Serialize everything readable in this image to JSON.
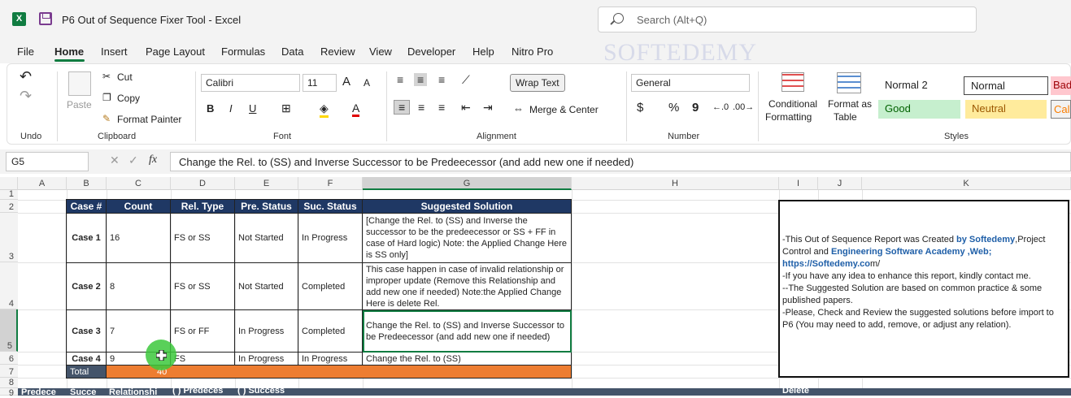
{
  "window": {
    "title": "P6 Out of Sequence Fixer Tool  -  Excel",
    "search_placeholder": "Search (Alt+Q)",
    "app_icon": "X",
    "watermark": "SOFTEDEMY"
  },
  "menu": [
    "File",
    "Home",
    "Insert",
    "Page Layout",
    "Formulas",
    "Data",
    "Review",
    "View",
    "Developer",
    "Help",
    "Nitro Pro"
  ],
  "ribbon": {
    "undo_label": "Undo",
    "clipboard": {
      "paste": "Paste",
      "cut": "Cut",
      "copy": "Copy",
      "format_painter": "Format Painter",
      "label": "Clipboard"
    },
    "font": {
      "name": "Calibri",
      "size": "11",
      "label": "Font",
      "bold": "B",
      "italic": "I",
      "underline": "U",
      "grow": "A",
      "shrink": "A",
      "color": "A"
    },
    "alignment": {
      "wrap_text": "Wrap Text",
      "merge_center": "Merge & Center",
      "label": "Alignment"
    },
    "number": {
      "format": "General",
      "currency": "$",
      "percent": "%",
      "comma": "9",
      "label": "Number"
    },
    "cond_format": {
      "line1": "Conditional",
      "line2": "Formatting"
    },
    "format_table": {
      "line1": "Format as",
      "line2": "Table"
    },
    "styles": {
      "label": "Styles",
      "items": [
        "Normal 2",
        "Normal",
        "Bad",
        "Good",
        "Neutral",
        "Calc"
      ]
    },
    "colors": {
      "good_bg": "#c6efce",
      "good_fg": "#006100",
      "neutral_bg": "#ffeb9c",
      "neutral_fg": "#9c5700",
      "bad_bg": "#ffc7ce",
      "bad_fg": "#9c0006"
    }
  },
  "formula_bar": {
    "cell": "G5",
    "fx": "fx",
    "formula": "Change the Rel. to (SS) and Inverse Successor to be Predeecessor (and add new one if needed)"
  },
  "columns": [
    "A",
    "B",
    "C",
    "D",
    "E",
    "F",
    "G",
    "H",
    "I",
    "J",
    "K"
  ],
  "rows": [
    "1",
    "2",
    "3",
    "4",
    "5",
    "6",
    "7",
    "8",
    "9"
  ],
  "table": {
    "headers": [
      "Case #",
      "Count",
      "Rel. Type",
      "Pre. Status",
      "Suc. Status",
      "Suggested Solution"
    ],
    "rows": [
      {
        "case": "Case 1",
        "count": "16",
        "rel": "FS or SS",
        "pre": "Not Started",
        "suc": "In Progress",
        "solution": "[Change the Rel. to (SS) and Inverse the successor to be the predeecessor or SS + FF in case of Hard logic) Note: the Applied Change Here is SS only]"
      },
      {
        "case": "Case 2",
        "count": "8",
        "rel": "FS or SS",
        "pre": "Not Started",
        "suc": "Completed",
        "solution": "This case happen in case of invalid relationship or improper update (Remove this Relationship and add new one if needed) Note:the Applied Change Here is delete Rel."
      },
      {
        "case": "Case 3",
        "count": "7",
        "rel": "FS or FF",
        "pre": "In Progress",
        "suc": "Completed",
        "solution": "Change the Rel. to (SS) and Inverse Successor to be Predeecessor (and add new one if needed)"
      },
      {
        "case": "Case 4",
        "count": "9",
        "rel": "FS",
        "pre": "In Progress",
        "suc": "In Progress",
        "solution": "Change the Rel. to (SS)"
      }
    ],
    "total_label": "Total",
    "total_value": "40",
    "header_bg": "#1f3864",
    "total_bg": "#ed7d31"
  },
  "row9": [
    "Predece",
    "Succe",
    "Relationshi",
    "( ) Predeces",
    "( ) Success",
    "Delete"
  ],
  "notes": {
    "line1a": "-This Out of Sequence Report was Created ",
    "line1b": "by Softedemy",
    "line1c": ",Project Control and ",
    "line1d": "Engineering Software Academy ,Web;",
    "line1e": "https://Softedemy.co",
    "line1f": "m/",
    "line2": "-If you have any idea to enhance this report, kindly contact me.",
    "line3": "--The Suggested Solution are based on common practice & some published papers.",
    "line4": "-Please, Check and Review the suggested solutions before import to P6 (You may need to add, remove, or adjust any relation)."
  }
}
